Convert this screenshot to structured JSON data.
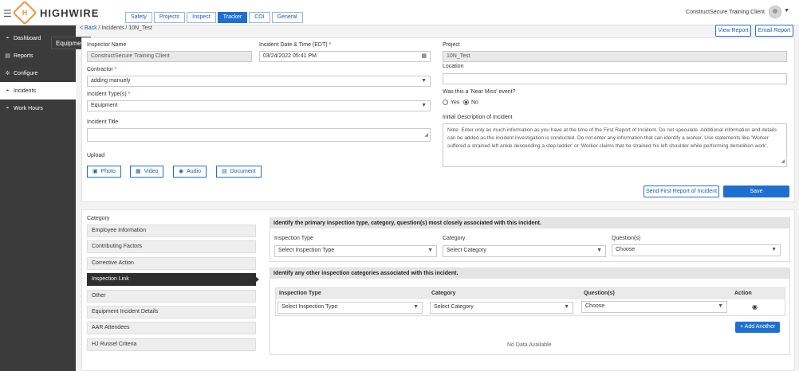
{
  "brand": {
    "name": "HIGHWIRE",
    "mark": "H"
  },
  "tabs": [
    {
      "label": "Safety"
    },
    {
      "label": "Projects"
    },
    {
      "label": "Inspect"
    },
    {
      "label": "Tracker"
    },
    {
      "label": "COI"
    },
    {
      "label": "General"
    }
  ],
  "user": {
    "name": "ConstructSecure Training Client"
  },
  "sidebar": {
    "items": [
      {
        "label": "Dashboard",
        "icon": "dashboard-icon"
      },
      {
        "label": "Reports",
        "icon": "document-icon"
      },
      {
        "label": "Configure",
        "icon": "gear-icon"
      },
      {
        "label": "Incidents",
        "icon": "dashboard-icon"
      },
      {
        "label": "Work Hours",
        "icon": "dashboard-icon"
      }
    ],
    "tooltip": "Equipment"
  },
  "breadcrumb": {
    "back": "< Back",
    "path": " / Incidents / 10N_Test"
  },
  "actions": {
    "view_report": "View Report",
    "email_report": "Email Report"
  },
  "form": {
    "inspector": {
      "label": "Inspector Name",
      "value": "ConstructSecure  Training Client"
    },
    "datetime": {
      "label": "Incident Date & Time (EDT)",
      "required": "*",
      "value": "03/24/2022 05:41 PM"
    },
    "project": {
      "label": "Project",
      "value": "10N_Test"
    },
    "contractor": {
      "label": "Contractor",
      "required": "*",
      "value": "adding manuely"
    },
    "location": {
      "label": "Location",
      "value": ""
    },
    "incident_types": {
      "label": "Incident Type(s)",
      "required": "*",
      "value": "Equipment"
    },
    "near_miss": {
      "label": "Was this a 'Near Miss' event?",
      "yes": "Yes",
      "no": "No",
      "selected": "No"
    },
    "title": {
      "label": "Incident Title",
      "value": ""
    },
    "description": {
      "label": "Initial Description of Incident",
      "placeholder": "Note: Enter only as much information as you have at the time of the First Report of Incident. Do not speculate. Additional information and details can be added as the incident investigation is conducted.  Do not enter any information that can identify a worker.  Use statements like 'Worker suffered a strained left ankle descending a step ladder' or 'Worker claims that he strained his left shoulder while performing demolition work'."
    },
    "upload": {
      "label": "Upload",
      "photo": "Photo",
      "video": "Video",
      "audio": "Audio",
      "document": "Document"
    },
    "send_report": "Send First Report of Incident",
    "save": "Save"
  },
  "category": {
    "label": "Category",
    "items": [
      "Employee Information",
      "Contributing Factors",
      "Corrective Action",
      "Inspection Link",
      "Other",
      "Equipment Incident Details",
      "AAR Attendees",
      "HJ Russel Criteria"
    ],
    "active": "Inspection Link"
  },
  "inspection_link": {
    "primary_heading": "Identify the primary inspection type, category, question(s) most closely associated with this incident.",
    "type_label": "Inspection Type",
    "category_label": "Category",
    "question_label": "Question(s)",
    "type_value": "Select Inspection Type",
    "category_value": "Select Category",
    "question_value": "Choose",
    "other_heading": "Identify any other inspection categories associated with this incident.",
    "table_headers": [
      "Inspection Type",
      "Category",
      "Question(s)",
      "Action"
    ],
    "row": {
      "type": "Select Inspection Type",
      "category": "Select Category",
      "question": "Choose"
    },
    "add_another": "+ Add Another",
    "empty": "No Data Available"
  }
}
